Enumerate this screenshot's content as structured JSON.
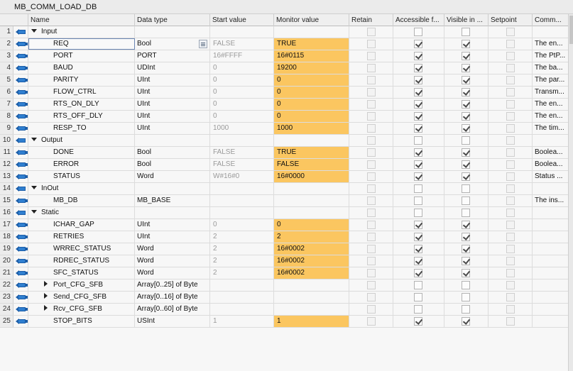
{
  "window": {
    "title": "MB_COMM_LOAD_DB"
  },
  "columns": {
    "name": "Name",
    "data_type": "Data type",
    "start_value": "Start value",
    "monitor_value": "Monitor value",
    "retain": "Retain",
    "accessible": "Accessible f...",
    "visible": "Visible in ...",
    "setpoint": "Setpoint",
    "comment": "Comm..."
  },
  "colors": {
    "monitor_highlight": "#fbc660",
    "icon_blue": "#2f7fd0"
  },
  "rows": [
    {
      "num": "1",
      "kind": "section",
      "expand": "down",
      "name": "Input",
      "type": "",
      "start": "",
      "monitor": "",
      "acc": false,
      "vis": false,
      "comment": ""
    },
    {
      "num": "2",
      "kind": "member",
      "name": "REQ",
      "type": "Bool",
      "start": "FALSE",
      "monitor": "TRUE",
      "acc": true,
      "vis": true,
      "comment": "The en...",
      "selected": true
    },
    {
      "num": "3",
      "kind": "member",
      "name": "PORT",
      "type": "PORT",
      "start": "16#FFFF",
      "monitor": "16#0115",
      "acc": true,
      "vis": true,
      "comment": "The PtP..."
    },
    {
      "num": "4",
      "kind": "member",
      "name": "BAUD",
      "type": "UDInt",
      "start": "0",
      "monitor": "19200",
      "acc": true,
      "vis": true,
      "comment": "The ba..."
    },
    {
      "num": "5",
      "kind": "member",
      "name": "PARITY",
      "type": "UInt",
      "start": "0",
      "monitor": "0",
      "acc": true,
      "vis": true,
      "comment": "The par..."
    },
    {
      "num": "6",
      "kind": "member",
      "name": "FLOW_CTRL",
      "type": "UInt",
      "start": "0",
      "monitor": "0",
      "acc": true,
      "vis": true,
      "comment": "Transm..."
    },
    {
      "num": "7",
      "kind": "member",
      "name": "RTS_ON_DLY",
      "type": "UInt",
      "start": "0",
      "monitor": "0",
      "acc": true,
      "vis": true,
      "comment": "The en..."
    },
    {
      "num": "8",
      "kind": "member",
      "name": "RTS_OFF_DLY",
      "type": "UInt",
      "start": "0",
      "monitor": "0",
      "acc": true,
      "vis": true,
      "comment": "The en..."
    },
    {
      "num": "9",
      "kind": "member",
      "name": "RESP_TO",
      "type": "UInt",
      "start": "1000",
      "monitor": "1000",
      "acc": true,
      "vis": true,
      "comment": "The tim..."
    },
    {
      "num": "10",
      "kind": "section",
      "expand": "down",
      "name": "Output",
      "type": "",
      "start": "",
      "monitor": "",
      "acc": false,
      "vis": false,
      "comment": ""
    },
    {
      "num": "11",
      "kind": "member",
      "name": "DONE",
      "type": "Bool",
      "start": "FALSE",
      "monitor": "TRUE",
      "acc": true,
      "vis": true,
      "comment": "Boolea..."
    },
    {
      "num": "12",
      "kind": "member",
      "name": "ERROR",
      "type": "Bool",
      "start": "FALSE",
      "monitor": "FALSE",
      "acc": true,
      "vis": true,
      "comment": "Boolea..."
    },
    {
      "num": "13",
      "kind": "member",
      "name": "STATUS",
      "type": "Word",
      "start": "W#16#0",
      "monitor": "16#0000",
      "acc": true,
      "vis": true,
      "comment": "Status ..."
    },
    {
      "num": "14",
      "kind": "section",
      "expand": "down",
      "name": "InOut",
      "type": "",
      "start": "",
      "monitor": "",
      "acc": false,
      "vis": false,
      "comment": ""
    },
    {
      "num": "15",
      "kind": "member",
      "name": "MB_DB",
      "type": "MB_BASE",
      "start": "",
      "monitor": "",
      "acc": false,
      "vis": false,
      "comment": "The ins..."
    },
    {
      "num": "16",
      "kind": "section",
      "expand": "down",
      "name": "Static",
      "type": "",
      "start": "",
      "monitor": "",
      "acc": false,
      "vis": false,
      "comment": ""
    },
    {
      "num": "17",
      "kind": "member",
      "name": "ICHAR_GAP",
      "type": "UInt",
      "start": "0",
      "monitor": "0",
      "acc": true,
      "vis": true,
      "comment": ""
    },
    {
      "num": "18",
      "kind": "member",
      "name": "RETRIES",
      "type": "UInt",
      "start": "2",
      "monitor": "2",
      "acc": true,
      "vis": true,
      "comment": ""
    },
    {
      "num": "19",
      "kind": "member",
      "name": "WRREC_STATUS",
      "type": "Word",
      "start": "2",
      "monitor": "16#0002",
      "acc": true,
      "vis": true,
      "comment": ""
    },
    {
      "num": "20",
      "kind": "member",
      "name": "RDREC_STATUS",
      "type": "Word",
      "start": "2",
      "monitor": "16#0002",
      "acc": true,
      "vis": true,
      "comment": ""
    },
    {
      "num": "21",
      "kind": "member",
      "name": "SFC_STATUS",
      "type": "Word",
      "start": "2",
      "monitor": "16#0002",
      "acc": true,
      "vis": true,
      "comment": ""
    },
    {
      "num": "22",
      "kind": "member",
      "expand": "right",
      "name": "Port_CFG_SFB",
      "type": "Array[0..25] of Byte",
      "start": "",
      "monitor": "",
      "acc": false,
      "vis": false,
      "comment": ""
    },
    {
      "num": "23",
      "kind": "member",
      "expand": "right",
      "name": "Send_CFG_SFB",
      "type": "Array[0..16] of Byte",
      "start": "",
      "monitor": "",
      "acc": false,
      "vis": false,
      "comment": ""
    },
    {
      "num": "24",
      "kind": "member",
      "expand": "right",
      "name": "Rcv_CFG_SFB",
      "type": "Array[0..60] of Byte",
      "start": "",
      "monitor": "",
      "acc": false,
      "vis": false,
      "comment": ""
    },
    {
      "num": "25",
      "kind": "member",
      "name": "STOP_BITS",
      "type": "USInt",
      "start": "1",
      "monitor": "1",
      "acc": true,
      "vis": true,
      "comment": ""
    }
  ]
}
